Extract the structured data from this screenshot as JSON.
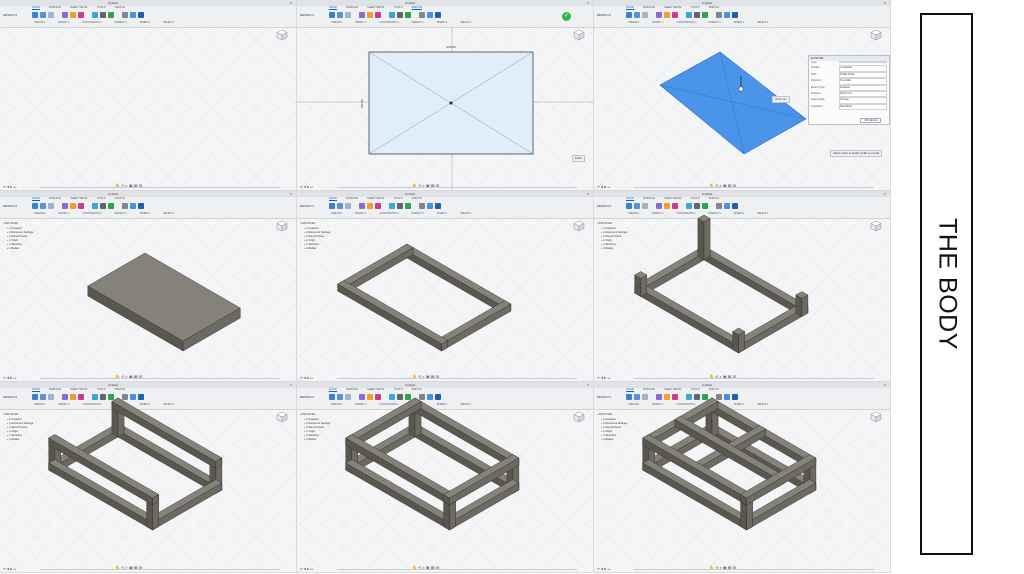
{
  "page": {
    "side_label": "THE BODY"
  },
  "toolbar": {
    "workspace": "DESIGN ▾",
    "tabs": [
      "SOLID",
      "SURFACE",
      "SHEET METAL",
      "TOOLS",
      "SKETCH"
    ],
    "groups": [
      "CREATE ▾",
      "MODIFY ▾",
      "CONSTRAINTS ▾",
      "INSPECT ▾",
      "INSERT ▾",
      "SELECT ▾"
    ],
    "finish_sketch": "FINISH SKETCH",
    "icon_colors": [
      "#3b7fd6",
      "#5b8fd8",
      "#a0b4cc",
      "#8a6bd1",
      "#f0a02a",
      "#cc3b8e",
      "#3aa6d6",
      "#5e6670",
      "#2fa34a",
      "#7d8792",
      "#4a90e2",
      "#1f5fae"
    ]
  },
  "browser": {
    "header": "◂ BROWSER",
    "items": [
      "Unsaved",
      "Document Settings",
      "Named Views",
      "Origin",
      "Sketches",
      "Bodies"
    ]
  },
  "sketch": {
    "dim_width": "600.00",
    "dim_height": "400.00"
  },
  "extrude_panel": {
    "title": "EXTRUDE",
    "rows": [
      {
        "label": "Type",
        "value": ""
      },
      {
        "label": "Profiles",
        "value": "1 selected"
      },
      {
        "label": "Start",
        "value": "Profile Plane"
      },
      {
        "label": "Direction",
        "value": "One Side"
      },
      {
        "label": "Extent Type",
        "value": "Distance"
      },
      {
        "label": "Distance",
        "value": "40.00 mm"
      },
      {
        "label": "Taper Angle",
        "value": "0.0 deg"
      },
      {
        "label": "Operation",
        "value": "New Body"
      }
    ],
    "ok": "OK",
    "cancel": "Cancel",
    "distance_readout": "40.00 mm"
  },
  "status_hints": {
    "finish": "Finish",
    "select_msg": "Select a face or sketch profile to extrude"
  },
  "panels": [
    {
      "name": "viewport-1",
      "title": "Untitled",
      "step": "empty-workspace"
    },
    {
      "name": "viewport-2",
      "title": "Untitled",
      "step": "rectangle-sketch"
    },
    {
      "name": "viewport-3",
      "title": "Untitled",
      "step": "extrude-profile"
    },
    {
      "name": "viewport-4",
      "title": "Untitled",
      "step": "solid-slab"
    },
    {
      "name": "viewport-5",
      "title": "Untitled",
      "step": "rectangular-frame"
    },
    {
      "name": "viewport-6",
      "title": "Untitled",
      "step": "frame-with-posts"
    },
    {
      "name": "viewport-7",
      "title": "Untitled",
      "step": "two-side-frames"
    },
    {
      "name": "viewport-8",
      "title": "Untitled",
      "step": "box-frame"
    },
    {
      "name": "viewport-9",
      "title": "Untitled",
      "step": "box-frame-with-crossbars"
    }
  ]
}
